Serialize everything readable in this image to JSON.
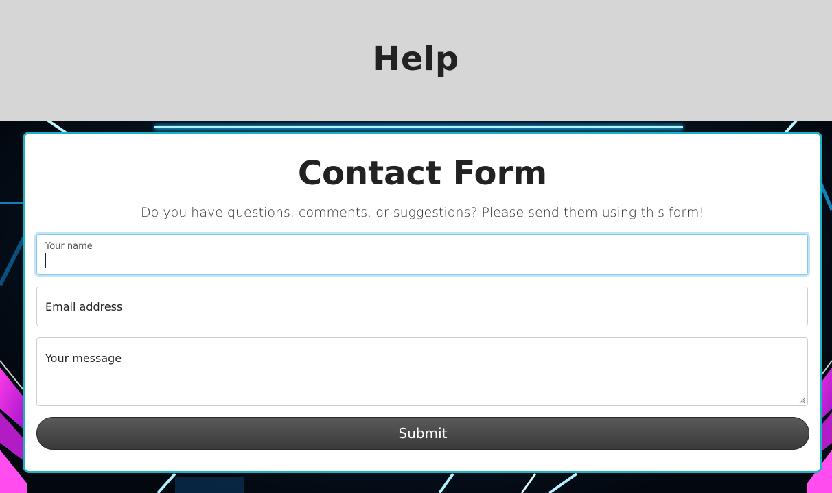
{
  "header": {
    "title": "Help"
  },
  "form": {
    "title": "Contact Form",
    "subtitle": "Do you have questions, comments, or suggestions? Please send them using this form!",
    "name_field": {
      "label": "Your name",
      "value": ""
    },
    "email_field": {
      "placeholder": "Email address",
      "value": ""
    },
    "message_field": {
      "placeholder": "Your message",
      "value": ""
    },
    "submit_label": "Submit"
  },
  "colors": {
    "header_bg": "#d6d6d6",
    "card_border": "#19b3c4",
    "focus_ring": "#bfe6fb",
    "button_bg": "#4a4a4a",
    "neon_cyan": "#22d3ff",
    "neon_magenta": "#e21fd0"
  },
  "icons": {
    "resize": "resize-handle-icon"
  }
}
